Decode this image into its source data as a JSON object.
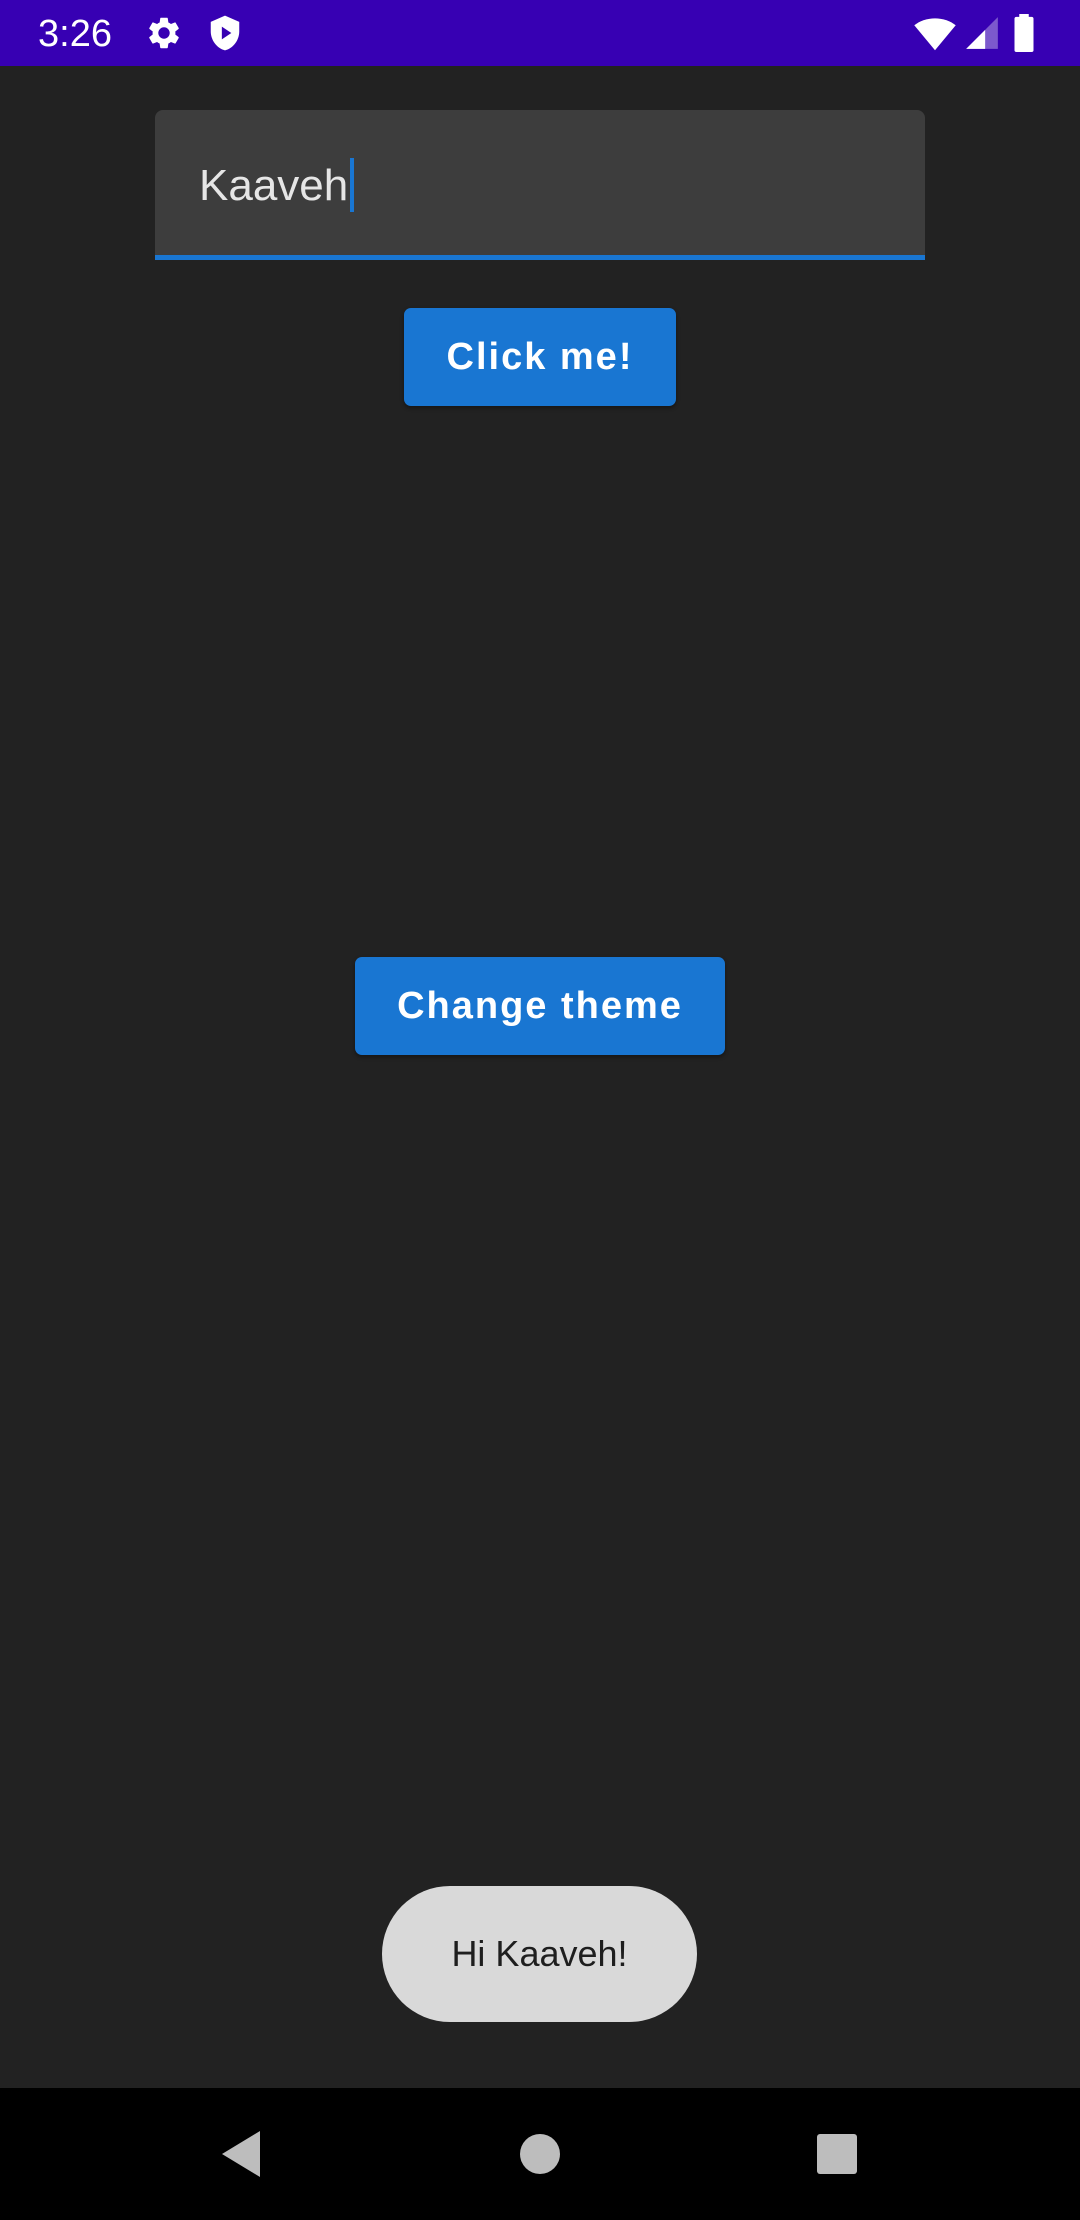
{
  "status_bar": {
    "time": "3:26",
    "icons": [
      "gear-icon",
      "shield-play-icon",
      "wifi-icon",
      "signal-icon",
      "battery-icon"
    ],
    "background_color": "#3700b3"
  },
  "name_field": {
    "value": "Kaaveh",
    "accent_color": "#1976d2"
  },
  "buttons": {
    "click_me_label": "Click me!",
    "change_theme_label": "Change theme",
    "color": "#1976d2"
  },
  "toast": {
    "message": "Hi Kaaveh!"
  },
  "nav_bar": {
    "icons": [
      "back-icon",
      "home-icon",
      "recents-icon"
    ]
  },
  "theme": {
    "background": "#222222"
  }
}
